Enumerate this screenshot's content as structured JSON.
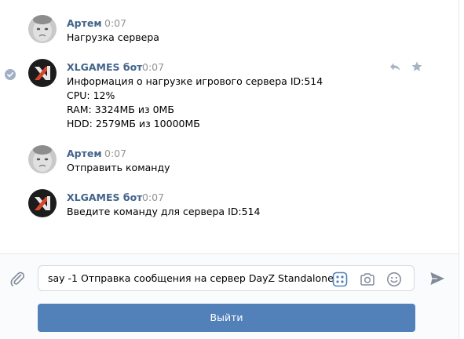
{
  "messages": [
    {
      "author": "Артем",
      "time": "0:07",
      "lines": [
        "Нагрузка сервера"
      ]
    },
    {
      "author": "XLGAMES бот",
      "time": "0:07",
      "lines": [
        "Информация о нагрузке игрового сервера ID:514",
        "CPU: 12%",
        "RAM: 3324МБ из 0МБ",
        "HDD: 2579МБ из 10000МБ"
      ]
    },
    {
      "author": "Артем",
      "time": "0:07",
      "lines": [
        "Отправить команду"
      ]
    },
    {
      "author": "XLGAMES бот",
      "time": "0:07",
      "lines": [
        "Введите команду для сервера ID:514"
      ]
    }
  ],
  "composer": {
    "input_value": "say -1 Отправка сообщения на сервер DayZ Standalone",
    "keyboard_button_label": "Выйти"
  },
  "icons": {
    "attach": "paperclip-icon",
    "bot_keyboard": "bot-keyboard-icon",
    "camera": "camera-icon",
    "emoji": "smile-icon",
    "send": "send-arrow-icon",
    "reply": "reply-icon",
    "favorite": "star-icon",
    "selected": "check-circle-icon"
  },
  "colors": {
    "author": "#42648b",
    "time": "#939393",
    "button": "#5181b8",
    "icon": "#828a99",
    "keyboard_icon": "#5181b8"
  }
}
